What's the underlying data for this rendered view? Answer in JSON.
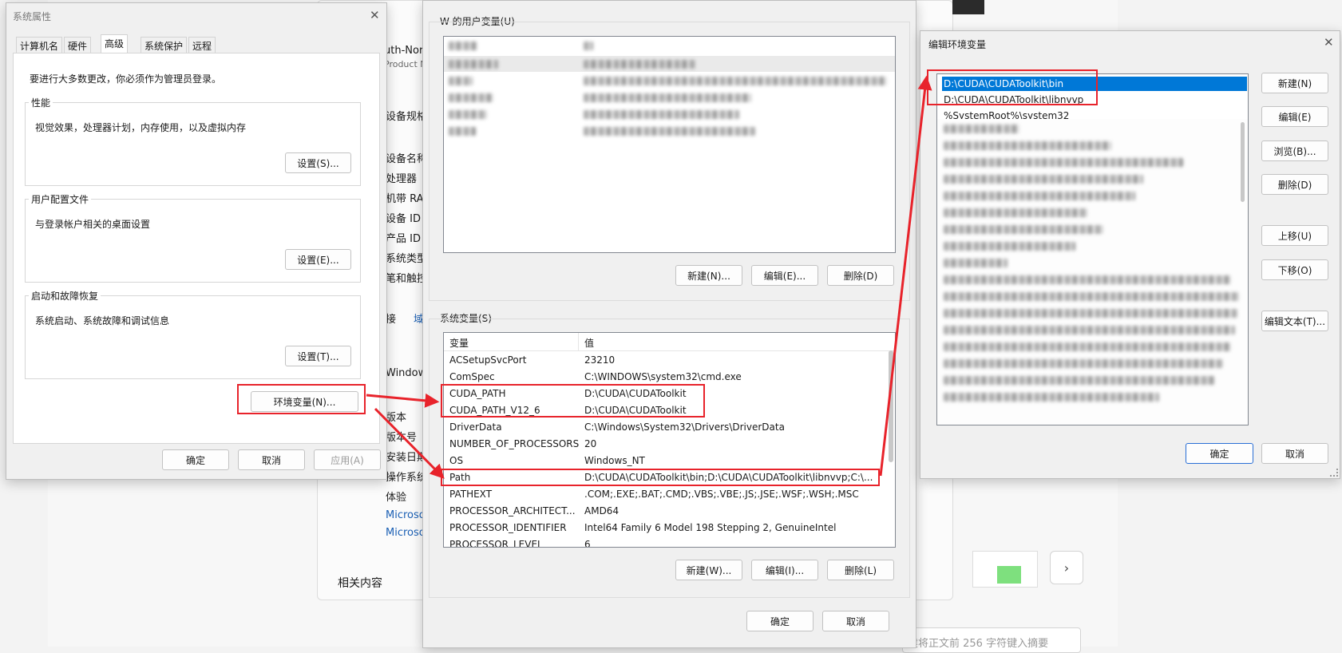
{
  "background": {
    "settings_items": [
      "uth-Nor",
      "Product N",
      "设备规格",
      "设备名称",
      "处理器",
      "机带 RA",
      "设备 ID",
      "产品 ID",
      "系统类型",
      "笔和触控",
      "接",
      "域",
      "Window",
      "版本",
      "版本号",
      "安装日期",
      "操作系统",
      "体验",
      "Microso",
      "Microso",
      "相关内容"
    ],
    "input_placeholder": "建将正文前 256 字符键入摘要"
  },
  "sysprops": {
    "title": "系统属性",
    "tabs": [
      "计算机名",
      "硬件",
      "高级",
      "系统保护",
      "远程"
    ],
    "admin_note": "要进行大多数更改，你必须作为管理员登录。",
    "perf_label": "性能",
    "perf_desc": "视觉效果，处理器计划，内存使用，以及虚拟内存",
    "perf_btn": "设置(S)...",
    "profile_label": "用户配置文件",
    "profile_desc": "与登录帐户相关的桌面设置",
    "profile_btn": "设置(E)...",
    "startup_label": "启动和故障恢复",
    "startup_desc": "系统启动、系统故障和调试信息",
    "startup_btn": "设置(T)...",
    "env_btn": "环境变量(N)...",
    "ok": "确定",
    "cancel": "取消",
    "apply": "应用(A)"
  },
  "envvars": {
    "user_label": "W 的用户变量(U)",
    "user_new": "新建(N)...",
    "user_edit": "编辑(E)...",
    "user_delete": "删除(D)",
    "sys_label": "系统变量(S)",
    "col_var": "变量",
    "col_val": "值",
    "rows": [
      {
        "name": "ACSetupSvcPort",
        "value": "23210"
      },
      {
        "name": "ComSpec",
        "value": "C:\\WINDOWS\\system32\\cmd.exe"
      },
      {
        "name": "CUDA_PATH",
        "value": "D:\\CUDA\\CUDAToolkit"
      },
      {
        "name": "CUDA_PATH_V12_6",
        "value": "D:\\CUDA\\CUDAToolkit"
      },
      {
        "name": "DriverData",
        "value": "C:\\Windows\\System32\\Drivers\\DriverData"
      },
      {
        "name": "NUMBER_OF_PROCESSORS",
        "value": "20"
      },
      {
        "name": "OS",
        "value": "Windows_NT"
      },
      {
        "name": "Path",
        "value": "D:\\CUDA\\CUDAToolkit\\bin;D:\\CUDA\\CUDAToolkit\\libnvvp;C:\\..."
      },
      {
        "name": "PATHEXT",
        "value": ".COM;.EXE;.BAT;.CMD;.VBS;.VBE;.JS;.JSE;.WSF;.WSH;.MSC"
      },
      {
        "name": "PROCESSOR_ARCHITECT...",
        "value": "AMD64"
      },
      {
        "name": "PROCESSOR_IDENTIFIER",
        "value": "Intel64 Family 6 Model 198 Stepping 2, GenuineIntel"
      },
      {
        "name": "PROCESSOR_LEVEL",
        "value": "6"
      }
    ],
    "sys_new": "新建(W)...",
    "sys_edit": "编辑(I)...",
    "sys_delete": "删除(L)",
    "ok": "确定",
    "cancel": "取消"
  },
  "editenv": {
    "title": "编辑环境变量",
    "entries": [
      "D:\\CUDA\\CUDAToolkit\\bin",
      "D:\\CUDA\\CUDAToolkit\\libnvvp",
      "%SystemRoot%\\system32"
    ],
    "btn_new": "新建(N)",
    "btn_edit": "编辑(E)",
    "btn_browse": "浏览(B)...",
    "btn_delete": "删除(D)",
    "btn_up": "上移(U)",
    "btn_down": "下移(O)",
    "btn_edit_text": "编辑文本(T)...",
    "ok": "确定",
    "cancel": "取消"
  },
  "colors": {
    "annotation_red": "#e8232b",
    "selection_blue": "#0078d7"
  }
}
